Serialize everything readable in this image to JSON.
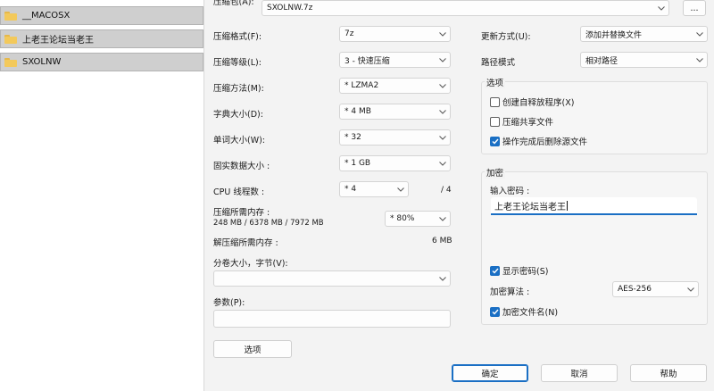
{
  "explorer": {
    "items": [
      {
        "label": "__MACOSX"
      },
      {
        "label": "上老王论坛当老王"
      },
      {
        "label": "SXOLNW"
      }
    ]
  },
  "dialog": {
    "archive_label": "压缩包(A):",
    "archive_value": "SXOLNW.7z",
    "browse_label": "...",
    "format_label": "压缩格式(F):",
    "format_value": "7z",
    "level_label": "压缩等级(L):",
    "level_value": "3 - 快速压缩",
    "method_label": "压缩方法(M):",
    "method_value": "* LZMA2",
    "dict_label": "字典大小(D):",
    "dict_value": "* 4 MB",
    "word_label": "单词大小(W):",
    "word_value": "* 32",
    "solid_label": "固实数据大小 :",
    "solid_value": "* 1 GB",
    "cpu_label": "CPU 线程数 :",
    "cpu_value": "* 4",
    "cpu_total": "/ 4",
    "mem_comp_label": "压缩所需内存 :",
    "mem_comp_detail": "248 MB / 6378 MB / 7972 MB",
    "mem_comp_value": "* 80%",
    "mem_decomp_label": "解压缩所需内存 :",
    "mem_decomp_value": "6 MB",
    "split_label": "分卷大小，字节(V):",
    "split_value": "",
    "params_label": "参数(P):",
    "params_value": "",
    "options_button": "选项",
    "update_label": "更新方式(U):",
    "update_value": "添加并替换文件",
    "path_label": "路径模式",
    "path_value": "相对路径",
    "options_group": {
      "title": "选项",
      "sfx": {
        "label": "创建自释放程序(X)",
        "checked": false
      },
      "shared": {
        "label": "压缩共享文件",
        "checked": false
      },
      "delete": {
        "label": "操作完成后删除源文件",
        "checked": true
      }
    },
    "encryption_group": {
      "title": "加密",
      "password_label": "输入密码 :",
      "password_value": "上老王论坛当老王",
      "show_password": {
        "label": "显示密码(S)",
        "checked": true
      },
      "method_label": "加密算法 :",
      "method_value": "AES-256",
      "encrypt_names": {
        "label": "加密文件名(N)",
        "checked": true
      }
    },
    "ok_button": "确定",
    "cancel_button": "取消",
    "help_button": "帮助"
  },
  "colors": {
    "accent": "#1a6fc4",
    "dialog_bg": "#f3f3f3",
    "explorer_row": "#cfcfcf",
    "folder": "#f3c95b"
  }
}
